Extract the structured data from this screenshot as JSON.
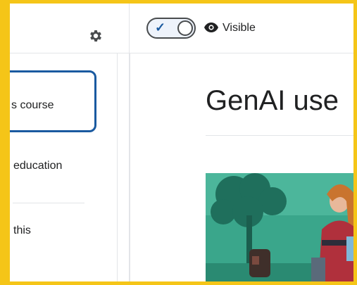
{
  "nav": {
    "items": [
      {
        "label": "s course",
        "selected": true
      },
      {
        "label": "education",
        "selected": false
      },
      {
        "label": "this",
        "selected": false
      }
    ]
  },
  "topbar": {
    "visibility_label": "Visible",
    "toggle_on": true
  },
  "main": {
    "title": "GenAI use"
  },
  "colors": {
    "accent": "#1a5aa0",
    "frame": "#f5c518",
    "hero_bg": "#2f9a80"
  },
  "icons": [
    "gear-icon",
    "checkmark-icon",
    "eye-icon"
  ]
}
